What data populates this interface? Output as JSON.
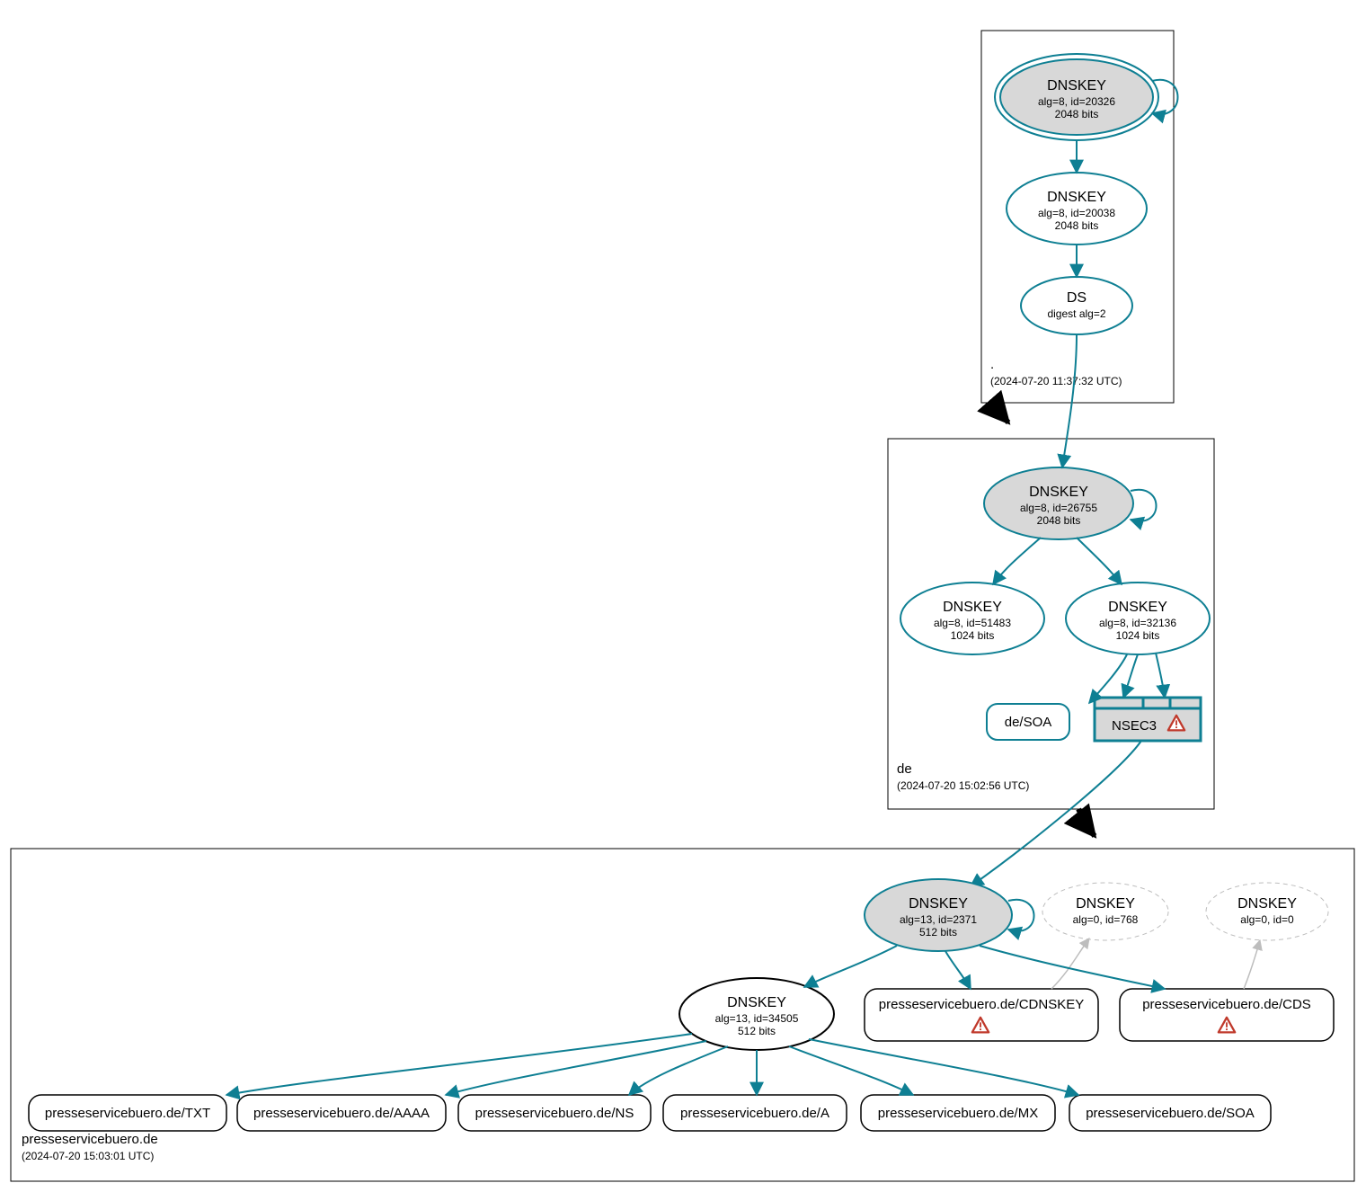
{
  "zones": {
    "root": {
      "name": ".",
      "timestamp": "(2024-07-20 11:37:32 UTC)"
    },
    "de": {
      "name": "de",
      "timestamp": "(2024-07-20 15:02:56 UTC)"
    },
    "domain": {
      "name": "presseservicebuero.de",
      "timestamp": "(2024-07-20 15:03:01 UTC)"
    }
  },
  "root_dnskey_ksk": {
    "title": "DNSKEY",
    "l2": "alg=8, id=20326",
    "l3": "2048 bits"
  },
  "root_dnskey_zsk": {
    "title": "DNSKEY",
    "l2": "alg=8, id=20038",
    "l3": "2048 bits"
  },
  "root_ds": {
    "title": "DS",
    "l2": "digest alg=2"
  },
  "de_dnskey_ksk": {
    "title": "DNSKEY",
    "l2": "alg=8, id=26755",
    "l3": "2048 bits"
  },
  "de_dnskey_51483": {
    "title": "DNSKEY",
    "l2": "alg=8, id=51483",
    "l3": "1024 bits"
  },
  "de_dnskey_32136": {
    "title": "DNSKEY",
    "l2": "alg=8, id=32136",
    "l3": "1024 bits"
  },
  "de_soa": {
    "label": "de/SOA"
  },
  "de_nsec3": {
    "label": "NSEC3"
  },
  "dom_dnskey_ksk": {
    "title": "DNSKEY",
    "l2": "alg=13, id=2371",
    "l3": "512 bits"
  },
  "dom_dnskey_768": {
    "title": "DNSKEY",
    "l2": "alg=0, id=768"
  },
  "dom_dnskey_0": {
    "title": "DNSKEY",
    "l2": "alg=0, id=0"
  },
  "dom_dnskey_zsk": {
    "title": "DNSKEY",
    "l2": "alg=13, id=34505",
    "l3": "512 bits"
  },
  "rr_cdnskey": "presseservicebuero.de/CDNSKEY",
  "rr_cds": "presseservicebuero.de/CDS",
  "rr_txt": "presseservicebuero.de/TXT",
  "rr_aaaa": "presseservicebuero.de/AAAA",
  "rr_ns": "presseservicebuero.de/NS",
  "rr_a": "presseservicebuero.de/A",
  "rr_mx": "presseservicebuero.de/MX",
  "rr_soa": "presseservicebuero.de/SOA"
}
